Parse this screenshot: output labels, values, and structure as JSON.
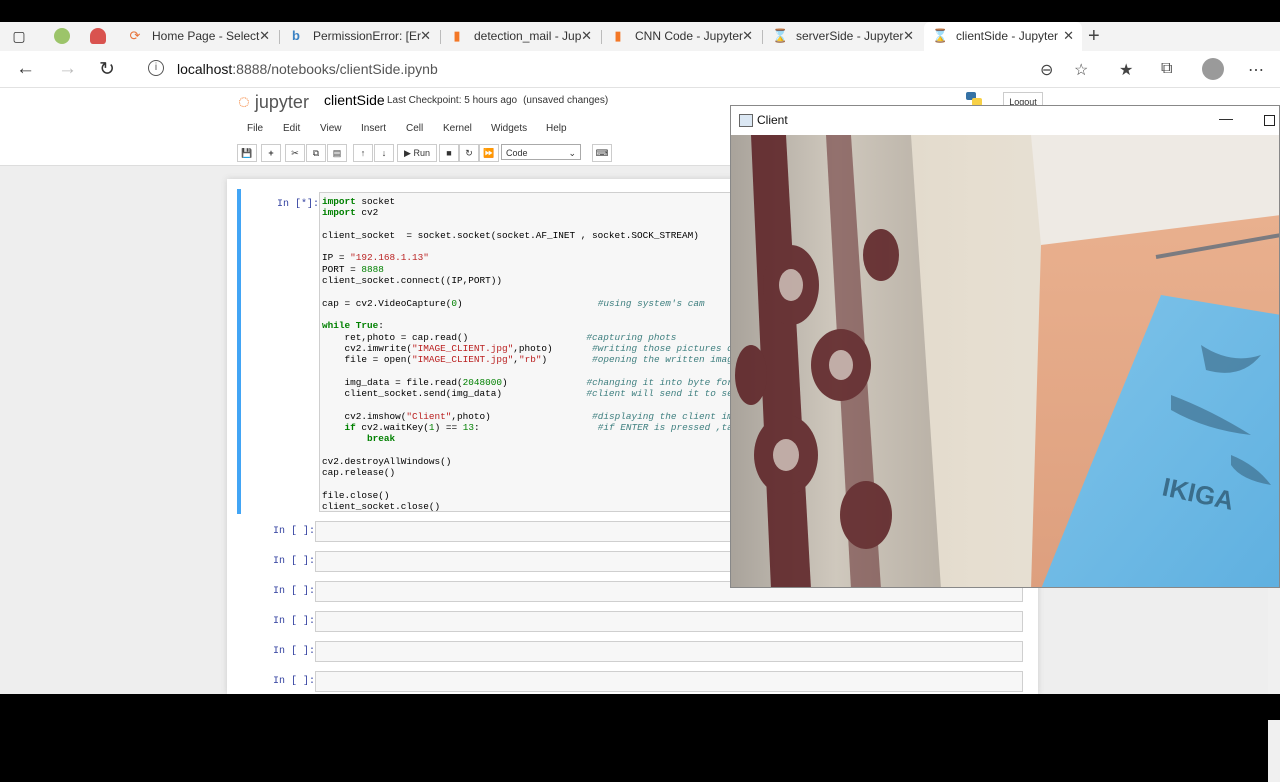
{
  "browser": {
    "tabs": [
      {
        "label": "Home Page - Select",
        "icon": "loading-spinner-icon"
      },
      {
        "label": "PermissionError: [Er",
        "icon": "bing-icon"
      },
      {
        "label": "detection_mail - Jup",
        "icon": "book-icon"
      },
      {
        "label": "CNN Code - Jupyter",
        "icon": "book-icon"
      },
      {
        "label": "serverSide - Jupyter",
        "icon": "hourglass-icon"
      },
      {
        "label": "clientSide - Jupyter",
        "icon": "hourglass-icon"
      }
    ],
    "url_host": "localhost",
    "url_rest": ":8888/notebooks/clientSide.ipynb"
  },
  "jupyter": {
    "logo_text": "jupyter",
    "notebook_name": "clientSide",
    "checkpoint": "Last Checkpoint: 5 hours ago",
    "unsaved": "(unsaved changes)",
    "logout": "Logout",
    "menus": [
      "File",
      "Edit",
      "View",
      "Insert",
      "Cell",
      "Kernel",
      "Widgets",
      "Help"
    ],
    "run_label": "Run",
    "cell_type": "Code",
    "colors": {
      "selected_border": "#42a5f5",
      "prompt": "#303f9f"
    }
  },
  "cells": {
    "first_prompt": "In [*]:",
    "empty_prompt": "In [ ]:"
  },
  "client_window": {
    "title": "Client"
  }
}
